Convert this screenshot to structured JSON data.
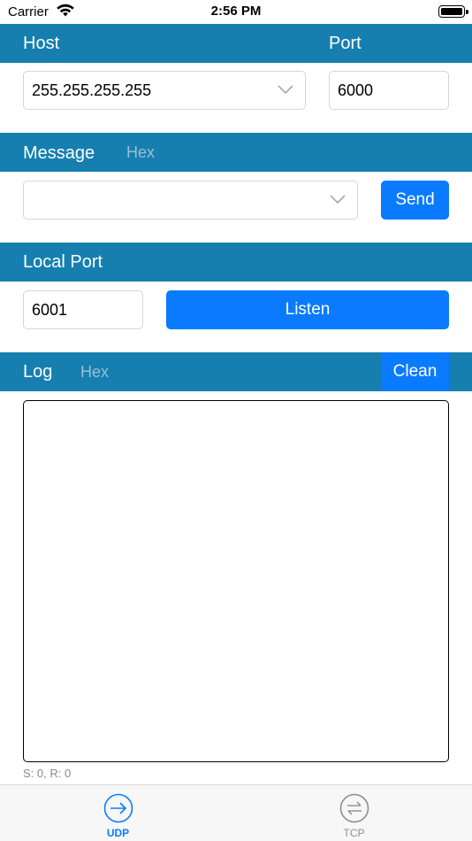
{
  "status_bar": {
    "carrier": "Carrier",
    "time": "2:56 PM",
    "wifi_icon": "wifi-icon",
    "battery_icon": "battery-icon"
  },
  "host_section": {
    "host_label": "Host",
    "port_label": "Port",
    "host_value": "255.255.255.255",
    "port_value": "6000"
  },
  "message_section": {
    "title": "Message",
    "hex_label": "Hex",
    "message_value": "",
    "send_label": "Send"
  },
  "local_port_section": {
    "title": "Local Port",
    "port_value": "6001",
    "listen_label": "Listen"
  },
  "log_section": {
    "title": "Log",
    "hex_label": "Hex",
    "clean_label": "Clean",
    "log_text": "",
    "counter": "S: 0, R: 0"
  },
  "tab_bar": {
    "tabs": [
      {
        "label": "UDP",
        "icon": "arrow-right-circle-icon",
        "active": true
      },
      {
        "label": "TCP",
        "icon": "exchange-arrows-circle-icon",
        "active": false
      }
    ]
  },
  "colors": {
    "header_bar": "#167fb0",
    "accent_blue": "#0a7bff",
    "hex_inactive": "#9bbfd2",
    "tab_inactive": "#8e8e8e"
  }
}
